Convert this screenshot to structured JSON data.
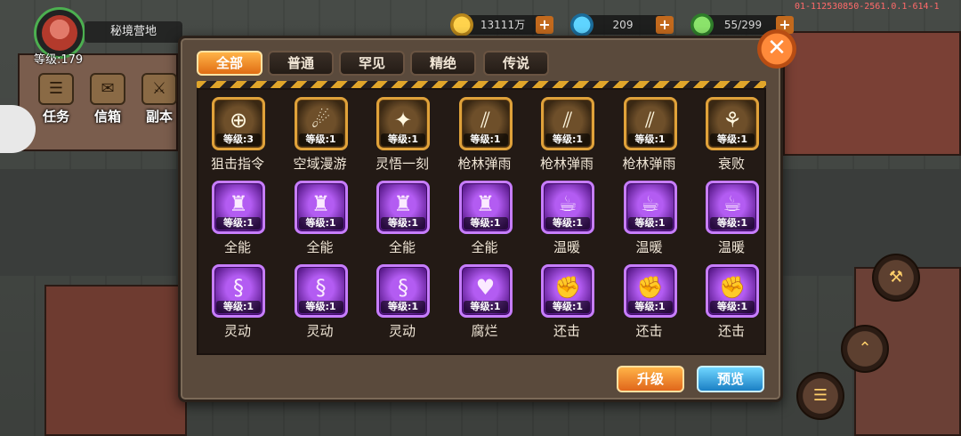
{
  "hud": {
    "location": "秘境营地",
    "level_text": "等级:179",
    "gold": "13111万",
    "gems": "209",
    "energy": "55/299",
    "debug_id": "01-112530850-2561.0.1-614-1"
  },
  "side_buttons": {
    "task": "任务",
    "mail": "信箱",
    "dungeon": "副本"
  },
  "modal": {
    "tabs": [
      "全部",
      "普通",
      "罕见",
      "精绝",
      "传说"
    ],
    "active_tab": 0,
    "close_glyph": "✕",
    "upgrade_label": "升级",
    "preview_label": "预览"
  },
  "skills": [
    {
      "name": "狙击指令",
      "level": "等级:3",
      "rarity": "gold",
      "icon": "crosshair-icon",
      "glyph": "⊕"
    },
    {
      "name": "空域漫游",
      "level": "等级:1",
      "rarity": "gold",
      "icon": "swirl-icon",
      "glyph": "☄"
    },
    {
      "name": "灵悟一刻",
      "level": "等级:1",
      "rarity": "gold",
      "icon": "star-burst-icon",
      "glyph": "✦"
    },
    {
      "name": "枪林弹雨",
      "level": "等级:1",
      "rarity": "gold",
      "icon": "bullets-icon",
      "glyph": "⫽"
    },
    {
      "name": "枪林弹雨",
      "level": "等级:1",
      "rarity": "gold",
      "icon": "bullets-icon",
      "glyph": "⫽"
    },
    {
      "name": "枪林弹雨",
      "level": "等级:1",
      "rarity": "gold",
      "icon": "bullets-icon",
      "glyph": "⫽"
    },
    {
      "name": "衰败",
      "level": "等级:1",
      "rarity": "gold",
      "icon": "withered-tree-icon",
      "glyph": "⚘"
    },
    {
      "name": "全能",
      "level": "等级:1",
      "rarity": "purple",
      "icon": "armor-icon",
      "glyph": "♜"
    },
    {
      "name": "全能",
      "level": "等级:1",
      "rarity": "purple",
      "icon": "armor-icon",
      "glyph": "♜"
    },
    {
      "name": "全能",
      "level": "等级:1",
      "rarity": "purple",
      "icon": "armor-icon",
      "glyph": "♜"
    },
    {
      "name": "全能",
      "level": "等级:1",
      "rarity": "purple",
      "icon": "armor-icon",
      "glyph": "♜"
    },
    {
      "name": "温暖",
      "level": "等级:1",
      "rarity": "purple",
      "icon": "hot-cup-icon",
      "glyph": "☕"
    },
    {
      "name": "温暖",
      "level": "等级:1",
      "rarity": "purple",
      "icon": "hot-cup-icon",
      "glyph": "☕"
    },
    {
      "name": "温暖",
      "level": "等级:1",
      "rarity": "purple",
      "icon": "hot-cup-icon",
      "glyph": "☕"
    },
    {
      "name": "灵动",
      "level": "等级:1",
      "rarity": "purple",
      "icon": "wind-swirl-icon",
      "glyph": "§"
    },
    {
      "name": "灵动",
      "level": "等级:1",
      "rarity": "purple",
      "icon": "wind-swirl-icon",
      "glyph": "§"
    },
    {
      "name": "灵动",
      "level": "等级:1",
      "rarity": "purple",
      "icon": "wind-swirl-icon",
      "glyph": "§"
    },
    {
      "name": "腐烂",
      "level": "等级:1",
      "rarity": "purple",
      "icon": "rot-heart-icon",
      "glyph": "♥"
    },
    {
      "name": "还击",
      "level": "等级:1",
      "rarity": "purple",
      "icon": "punch-icon",
      "glyph": "✊"
    },
    {
      "name": "还击",
      "level": "等级:1",
      "rarity": "purple",
      "icon": "punch-icon",
      "glyph": "✊"
    },
    {
      "name": "还击",
      "level": "等级:1",
      "rarity": "purple",
      "icon": "punch-icon",
      "glyph": "✊"
    }
  ]
}
